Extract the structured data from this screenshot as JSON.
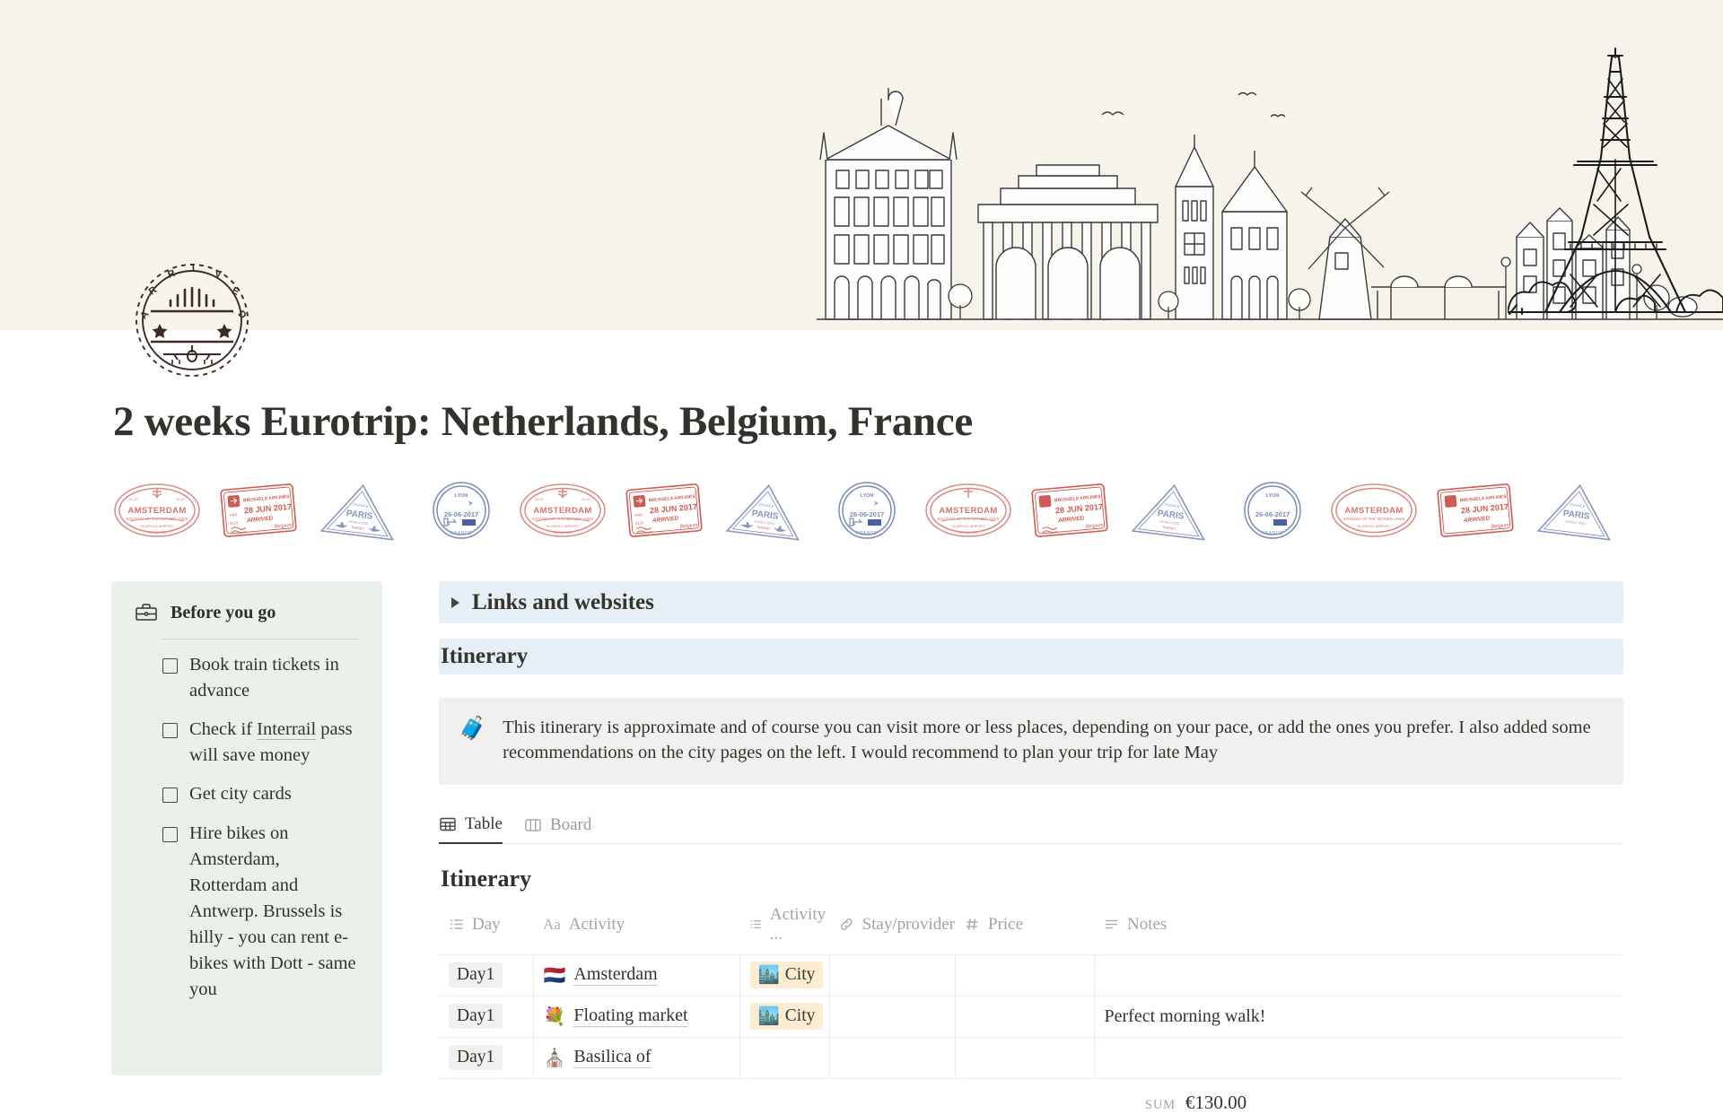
{
  "cover": {
    "logo_text": "ARRIVED",
    "illustration": "european-cityscape-line-art",
    "bg_color": "#F7F4EC"
  },
  "page_title": "2 weeks Eurotrip: Netherlands, Belgium, France",
  "stamps": [
    {
      "name": "amsterdam-stamp",
      "label": "AMSTERDAM",
      "sub": "KINGDOM OF THE NETHERLANDS",
      "color": "#d4766f"
    },
    {
      "name": "brussels-airlines-stamp",
      "label": "BRUSSELS AIRLINES",
      "date": "28 JUN 2017",
      "status": "ARRIVED",
      "country": "Belgium",
      "color": "#cf5b52"
    },
    {
      "name": "paris-stamp",
      "label": "PARIS",
      "country": "FRANCE",
      "color": "#8e95bd"
    },
    {
      "name": "lyon-stamp",
      "label": "LYON",
      "date": "26-06-2017",
      "country": "FRANCE",
      "color": "#7d8cb5"
    }
  ],
  "sidebar": {
    "icon": "briefcase-icon",
    "heading": "Before you go",
    "items": [
      {
        "text": "Book train tickets in advance",
        "checked": false
      },
      {
        "text": "Check if ",
        "link": "Interrail",
        "text_after": " pass will save money",
        "checked": false
      },
      {
        "text": "Get city cards",
        "checked": false
      },
      {
        "text": "Hire bikes on Amsterdam, Rotterdam and Antwerp. Brussels is hilly - you can rent e-bikes with Dott - same you",
        "checked": false
      }
    ]
  },
  "main": {
    "toggle_section": {
      "label": "Links and websites",
      "expanded": false
    },
    "itinerary_section": {
      "label": "Itinerary"
    },
    "callout": {
      "emoji": "🧳",
      "text": "This itinerary is approximate and of course you can visit more or less places, depending on your pace, or add the ones you prefer. I also added some recommendations on the city pages on the left. I would recommend to plan your trip for late May"
    },
    "views": [
      {
        "label": "Table",
        "icon": "table-icon",
        "active": true
      },
      {
        "label": "Board",
        "icon": "board-icon",
        "active": false
      }
    ],
    "database": {
      "title": "Itinerary",
      "columns": [
        {
          "label": "Day",
          "icon": "select-icon",
          "type": "select"
        },
        {
          "label": "Activity",
          "icon": "title-icon",
          "type": "title"
        },
        {
          "label": "Activity ...",
          "icon": "select-icon",
          "type": "select"
        },
        {
          "label": "Stay/provider",
          "icon": "link-icon",
          "type": "url"
        },
        {
          "label": "Price",
          "icon": "number-icon",
          "type": "number"
        },
        {
          "label": "Notes",
          "icon": "text-icon",
          "type": "text"
        }
      ],
      "rows": [
        {
          "day": "Day1",
          "activity_emoji": "🇳🇱",
          "activity": "Amsterdam",
          "activity_type": "City",
          "activity_type_emoji": "🏙️",
          "stay": "",
          "price": "",
          "notes": ""
        },
        {
          "day": "Day1",
          "activity_emoji": "💐",
          "activity": "Floating market",
          "activity_type": "City",
          "activity_type_emoji": "🏙️",
          "stay": "",
          "price": "",
          "notes": "Perfect morning walk!"
        },
        {
          "day": "Day1",
          "activity_emoji": "⛪",
          "activity": "Basilica of",
          "activity_type": "",
          "activity_type_emoji": "",
          "stay": "",
          "price": "",
          "notes": ""
        }
      ],
      "footer": {
        "label": "SUM",
        "value": "€130.00"
      }
    }
  },
  "colors": {
    "cover_bg": "#F7F4EC",
    "sidebar_bg": "#EAF0EA",
    "section_bar": "#E5EFF5",
    "callout_bg": "#F1F0EE",
    "tag_bg": "#FBECD2",
    "text": "#33322E"
  }
}
